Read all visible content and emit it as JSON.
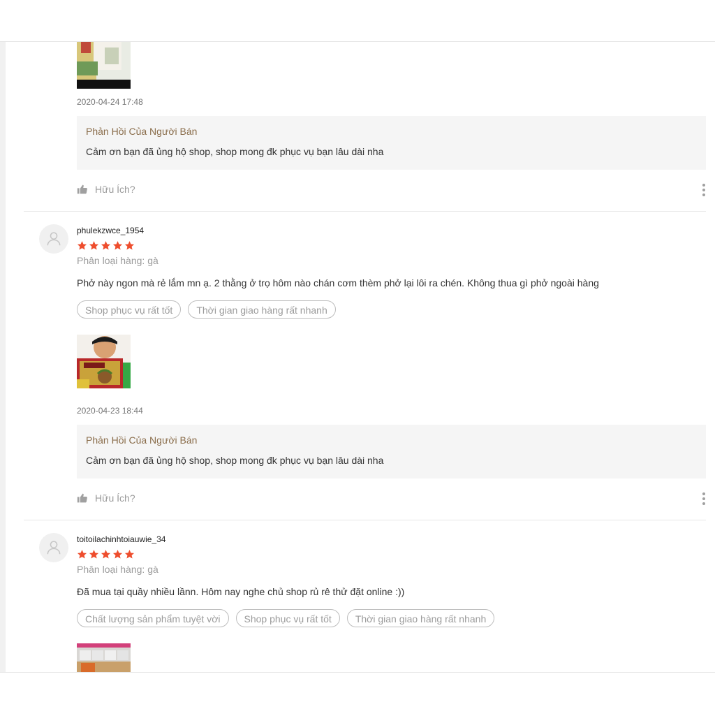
{
  "colors": {
    "star": "#ee4d2d",
    "reply_title": "#8a6d4b",
    "reply_bg": "#f5f5f5",
    "muted": "#9b9b9b"
  },
  "reviews": [
    {
      "timestamp": "2020-04-24 17:48",
      "reply": {
        "title": "Phản Hồi Của Người Bán",
        "text": "Cảm ơn bạn đã ủng hộ shop, shop mong  đk phục vụ bạn lâu dài nha"
      },
      "helpful_label": "Hữu Ích?"
    },
    {
      "username": "phulekzwce_1954",
      "rating": 5,
      "variation": "Phân loại hàng: gà",
      "comment": "Phở này ngon mà rẻ lắm mn ạ. 2 thằng ở trọ hôm nào chán cơm thèm phở lại lôi ra chén. Không thua gì phở ngoài hàng",
      "tags": [
        "Shop phục vụ rất tốt",
        "Thời gian giao hàng rất nhanh"
      ],
      "timestamp": "2020-04-23 18:44",
      "reply": {
        "title": "Phản Hồi Của Người Bán",
        "text": "Cảm ơn bạn đã ủng hộ shop, shop mong  đk phục vụ bạn lâu dài nha"
      },
      "helpful_label": "Hữu Ích?"
    },
    {
      "username": "toitoilachinhtoiauwie_34",
      "rating": 5,
      "variation": "Phân loại hàng: gà",
      "comment": "Đã mua tại quầy nhiều lầnn. Hôm nay nghe chủ shop rủ rê thử đặt online :))",
      "tags": [
        "Chất lượng sản phẩm tuyệt vời",
        "Shop phục vụ rất tốt",
        "Thời gian giao hàng rất nhanh"
      ]
    }
  ]
}
